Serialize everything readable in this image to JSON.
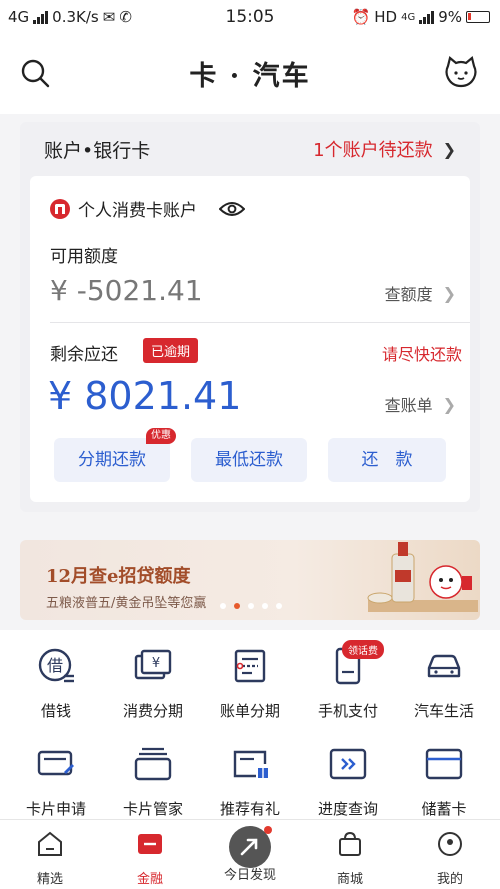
{
  "status_bar": {
    "network": "4G",
    "speed": "0.3K/s",
    "time": "15:05",
    "hd": "HD",
    "net2": "4G",
    "battery": "9%"
  },
  "header": {
    "title": "卡 · 汽车"
  },
  "account": {
    "section_title": "账户•银行卡",
    "due_notice": "1个账户待还款",
    "account_name": "个人消费卡账户",
    "available_label": "可用额度",
    "available_amount": "¥ -5021.41",
    "check_limit": "查额度",
    "remaining_label": "剩余应还",
    "overdue_badge": "已逾期",
    "urge_text": "请尽快还款",
    "remaining_amount": "¥ 8021.41",
    "check_bill": "查账单",
    "buttons": {
      "installment": "分期还款",
      "promo_tag": "优惠",
      "minimum": "最低还款",
      "repay": "还　款"
    }
  },
  "banner": {
    "title": "12月查e招贷额度",
    "subtitle": "五粮液普五/黄金吊坠等您赢"
  },
  "grid": [
    {
      "label": "借钱",
      "icon": "borrow-icon"
    },
    {
      "label": "消费分期",
      "icon": "consumer-installment-icon"
    },
    {
      "label": "账单分期",
      "icon": "bill-installment-icon"
    },
    {
      "label": "手机支付",
      "icon": "mobile-pay-icon",
      "tag": "领话费"
    },
    {
      "label": "汽车生活",
      "icon": "car-icon"
    },
    {
      "label": "卡片申请",
      "icon": "card-apply-icon"
    },
    {
      "label": "卡片管家",
      "icon": "card-manager-icon"
    },
    {
      "label": "推荐有礼",
      "icon": "recommend-gift-icon"
    },
    {
      "label": "进度查询",
      "icon": "progress-query-icon"
    },
    {
      "label": "储蓄卡",
      "icon": "debit-card-icon"
    }
  ],
  "nav": [
    {
      "label": "精选",
      "icon": "home-icon"
    },
    {
      "label": "金融",
      "icon": "finance-icon",
      "active": true
    },
    {
      "label": "今日发现",
      "icon": "discover-icon"
    },
    {
      "label": "商城",
      "icon": "shop-icon"
    },
    {
      "label": "我的",
      "icon": "profile-icon"
    }
  ],
  "colors": {
    "brand_red": "#d7282e",
    "accent_blue": "#2c5ecf"
  }
}
